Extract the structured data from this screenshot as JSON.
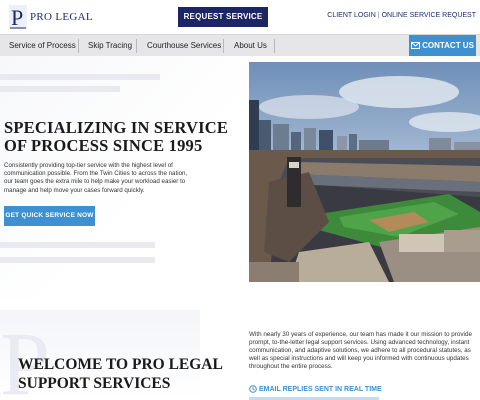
{
  "header": {
    "logo_text": "PRO LEGAL",
    "request_button": "REQUEST SERVICE",
    "client_login": "CLIENT LOGIN",
    "separator": "|",
    "online_request": "ONLINE SERVICE REQUEST"
  },
  "nav": {
    "items": [
      {
        "label": "Service of Process"
      },
      {
        "label": "Skip Tracing"
      },
      {
        "label": "Courthouse Services"
      },
      {
        "label": "About Us"
      }
    ],
    "contact_label": "CONTACT US"
  },
  "hero": {
    "title_line1": "SPECIALIZING IN SERVICE",
    "title_line2": "OF PROCESS SINCE 1995",
    "text": "Consistently providing top-tier service with the highest level of communication possible. From the Twin Cities to across the nation, our team goes the extra mile to help make your workload easier to manage and help move your cases forward quickly.",
    "button": "GET QUICK SERVICE NOW"
  },
  "welcome": {
    "title_line1": "WELCOME TO PRO LEGAL",
    "title_line2": "SUPPORT SERVICES",
    "text": "With nearly 30 years of experience, our team has made it our mission to provide prompt, to-the-letter legal support services. Using advanced technology, instant communication, and adaptive solutions, we adhere to all procedural statutes, as well as special instructions and will keep you informed with continuous updates throughout the entire process.",
    "feature": "EMAIL REPLIES SENT IN REAL TIME"
  },
  "colors": {
    "navy": "#1c2566",
    "accent_blue": "#3f90d0",
    "nav_bg": "#e6e6e8"
  },
  "icons": [
    "logo-monogram-icon",
    "envelope-icon",
    "clock-icon"
  ]
}
